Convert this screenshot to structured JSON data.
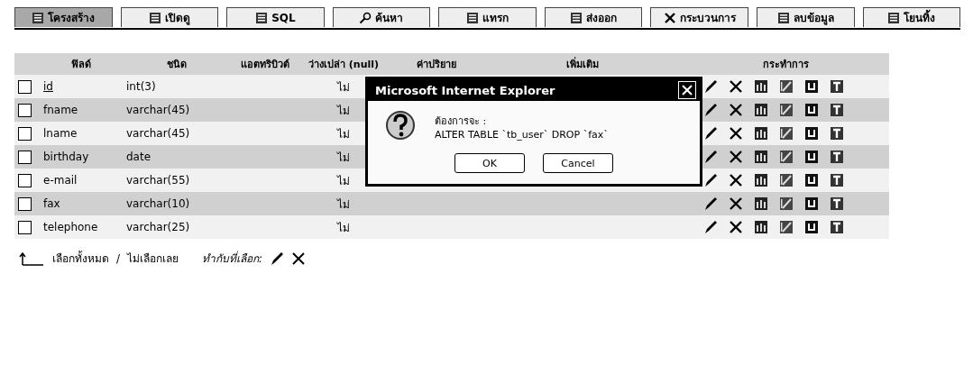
{
  "tabs": [
    {
      "label": "โครงสร้าง",
      "selected": true
    },
    {
      "label": "เปิดดู",
      "selected": false
    },
    {
      "label": "SQL",
      "selected": false
    },
    {
      "label": "ค้นหา",
      "selected": false
    },
    {
      "label": "แทรก",
      "selected": false
    },
    {
      "label": "ส่งออก",
      "selected": false
    },
    {
      "label": "กระบวนการ",
      "selected": false
    },
    {
      "label": "ลบข้อมูล",
      "selected": false
    },
    {
      "label": "โยนทิ้ง",
      "selected": false
    }
  ],
  "table": {
    "columns": [
      "ฟิลด์",
      "ชนิด",
      "แอตทริบิวต์",
      "ว่างเปล่า (null)",
      "ค่าปริยาย",
      "เพิ่มเติม",
      "กระทำการ"
    ],
    "rows": [
      {
        "field": "id",
        "type": "int(3)",
        "null": "ไม่",
        "checked": false,
        "primary_key": true
      },
      {
        "field": "fname",
        "type": "varchar(45)",
        "null": "ไม่",
        "checked": false,
        "primary_key": false
      },
      {
        "field": "lname",
        "type": "varchar(45)",
        "null": "ไม่",
        "checked": false,
        "primary_key": false
      },
      {
        "field": "birthday",
        "type": "date",
        "null": "ไม่",
        "checked": false,
        "primary_key": false
      },
      {
        "field": "e-mail",
        "type": "varchar(55)",
        "null": "ไม่",
        "checked": false,
        "primary_key": false
      },
      {
        "field": "fax",
        "type": "varchar(10)",
        "null": "ไม่",
        "checked": false,
        "primary_key": false
      },
      {
        "field": "telephone",
        "type": "varchar(25)",
        "null": "ไม่",
        "checked": false,
        "primary_key": false
      }
    ]
  },
  "footer": {
    "check_all": "เลือกทั้งหมด",
    "separator": "/",
    "uncheck_all": "ไม่เลือกเลย",
    "with_selected": "ทำกับที่เลือก:"
  },
  "dialog": {
    "title": "Microsoft Internet Explorer",
    "message_lines": [
      "ต้องการจะ :",
      "ALTER TABLE `tb_user` DROP `fax`"
    ],
    "buttons": [
      "OK",
      "Cancel"
    ]
  }
}
